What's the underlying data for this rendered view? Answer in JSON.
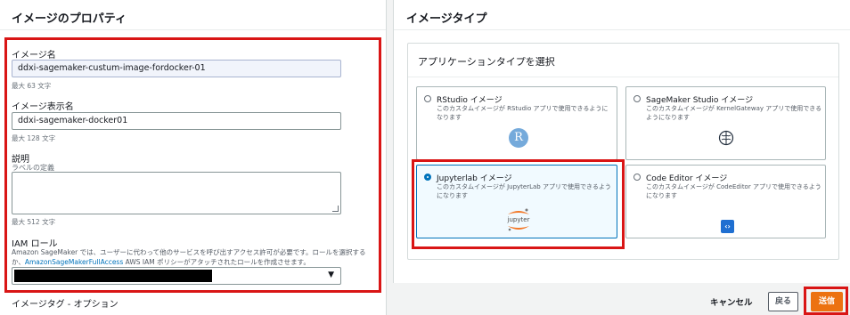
{
  "left": {
    "title": "イメージのプロパティ",
    "image_name": {
      "label": "イメージ名",
      "value": "ddxi-sagemaker-custum-image-fordocker-01",
      "hint": "最大 63 文字"
    },
    "display_name": {
      "label": "イメージ表示名",
      "value": "ddxi-sagemaker-docker01",
      "hint": "最大 128 文字"
    },
    "description": {
      "label": "説明",
      "sublabel": "ラベルの定義",
      "hint": "最大 512 文字"
    },
    "iam": {
      "label": "IAM ロール",
      "desc_1": "Amazon SageMaker では、ユーザーに代わって他のサービスを呼び出すアクセス許可が必要です。ロールを選択するか、",
      "link": "AmazonSageMakerFullAccess",
      "desc_2": " AWS IAM ポリシーがアタッチされたロールを作成させます。"
    },
    "tags_title": "イメージタグ - オプション"
  },
  "right": {
    "title": "イメージタイプ",
    "inner_title": "アプリケーションタイプを選択",
    "tiles": [
      {
        "title": "RStudio イメージ",
        "desc": "このカスタムイメージが RStudio アプリで使用できるようになります",
        "icon": "rstudio-icon",
        "selected": false
      },
      {
        "title": "SageMaker Studio イメージ",
        "desc": "このカスタムイメージが KernelGateway アプリで使用できるようになります",
        "icon": "sagemaker-brain-icon",
        "selected": false
      },
      {
        "title": "Jupyterlab イメージ",
        "desc": "このカスタムイメージが JupyterLab アプリで使用できるようになります",
        "icon": "jupyter-icon",
        "selected": true
      },
      {
        "title": "Code Editor イメージ",
        "desc": "このカスタムイメージが CodeEditor アプリで使用できるようになります",
        "icon": "code-editor-icon",
        "selected": false
      }
    ],
    "rstudio_glyph": "R",
    "jupyter_text": "jupyter"
  },
  "footer": {
    "cancel": "キャンセル",
    "back": "戻る",
    "submit": "送信"
  },
  "colors": {
    "highlight": "#d91515",
    "primary": "#ec7211",
    "selected_border": "#0073bb"
  }
}
